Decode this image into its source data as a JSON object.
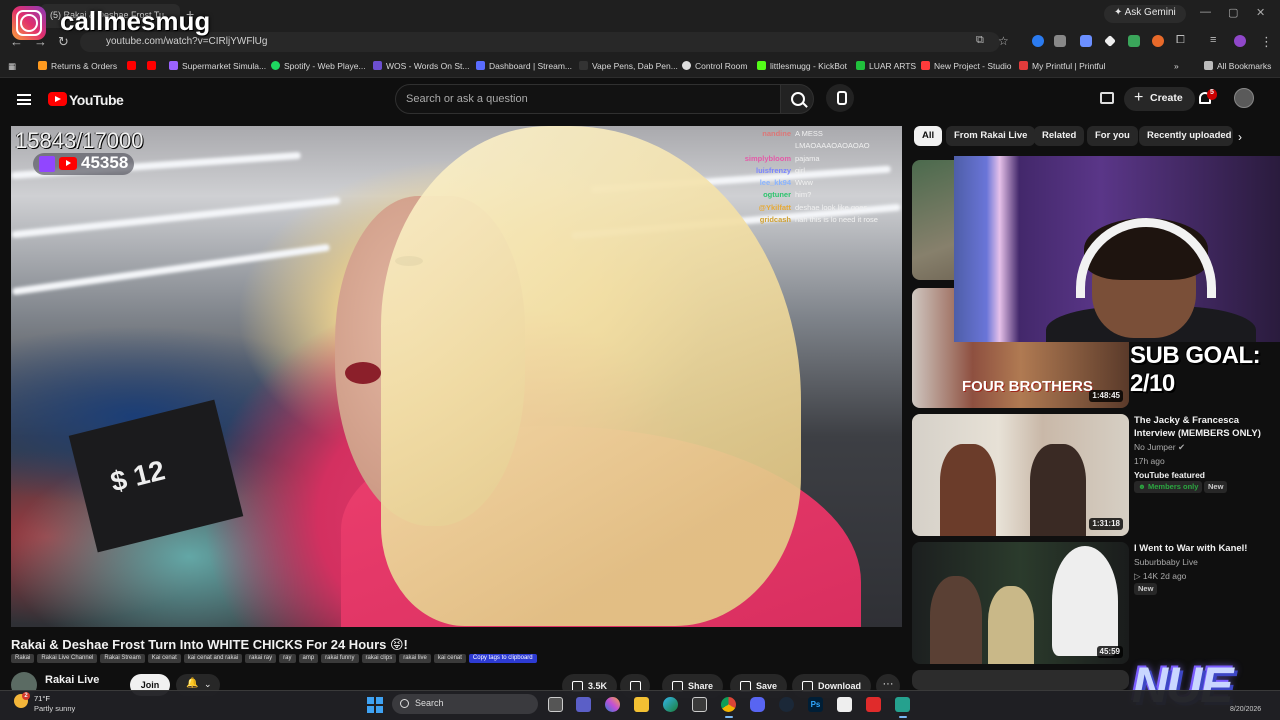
{
  "browser": {
    "tab_title": "(5) Rakai & Deshae Frost Tu",
    "new_tab_label": "+",
    "ask_gemini": "Ask Gemini",
    "url": "youtube.com/watch?v=CIRljYWFlUg",
    "bookmarks": [
      {
        "label": "Returns & Orders",
        "color": "#ff9a1f"
      },
      {
        "label": "",
        "color": "#ff0000"
      },
      {
        "label": "",
        "color": "#ff0000"
      },
      {
        "label": "Supermarket Simula...",
        "color": "#9a62ff"
      },
      {
        "label": "Spotify - Web Playe...",
        "color": "#1ed760"
      },
      {
        "label": "WOS - Words On St...",
        "color": "#6c4fd1"
      },
      {
        "label": "Dashboard | Stream...",
        "color": "#5a6cff"
      },
      {
        "label": "Vape Pens, Dab Pen...",
        "color": "#333333"
      },
      {
        "label": "Control Room",
        "color": "#dddddd"
      },
      {
        "label": "littlesmugg - KickBot",
        "color": "#53fc18"
      },
      {
        "label": "LUAR ARTS",
        "color": "#20c13c"
      },
      {
        "label": "New Project - Studio",
        "color": "#ff3b3b"
      },
      {
        "label": "My Printful | Printful",
        "color": "#e23b3b"
      }
    ],
    "all_bookmarks": "All Bookmarks"
  },
  "watermark": {
    "handle": "callmesmug"
  },
  "youtube": {
    "logo_text": "YouTube",
    "search_placeholder": "Search or ask a question",
    "create_label": "Create",
    "notification_count": "5"
  },
  "video": {
    "sub_counter": "15843/17000",
    "viewer_count": "45358",
    "chat": [
      {
        "user": "nandine",
        "msg": "A MESS"
      },
      {
        "user": "",
        "msg": "LMAOAAAOAOAOAO"
      },
      {
        "user": "simplybloom",
        "msg": "pajama"
      },
      {
        "user": "luisfrenzy",
        "msg": "girl"
      },
      {
        "user": "lee_kk94",
        "msg": "Www"
      },
      {
        "user": "ogtuner",
        "msg": "him?"
      },
      {
        "user": "@Ykilfatt",
        "msg": "deshae look like goes"
      },
      {
        "user": "gridcash",
        "msg": "nah this is lo need it rose"
      }
    ],
    "price_sign": "$ 12",
    "title": "Rakai & Deshae Frost Turn Into WHITE CHICKS For 24 Hours 😝!",
    "tags": [
      "Rakai",
      "Rakai Live Channel",
      "Rakai Stream",
      "Kai cenat",
      "kai cenat and rakai",
      "rakai ray",
      "ray",
      "amp",
      "rakai funny",
      "rakai clips",
      "rakai live",
      "kai cenat"
    ],
    "copy_tags": "Copy tags to clipboard",
    "channel": "Rakai Live",
    "join": "Join",
    "likes": "3.5K",
    "share": "Share",
    "save": "Save",
    "download": "Download",
    "more": "···"
  },
  "overlay": {
    "sub_goal": "SUB GOAL: 2/10",
    "nue_logo": "NUE"
  },
  "sidebar": {
    "chips": [
      "All",
      "From Rakai Live",
      "Related",
      "For you",
      "Recently uploaded"
    ],
    "videos": [
      {
        "title": "",
        "channel": "",
        "meta": "",
        "duration": "",
        "badge": ""
      },
      {
        "title": "",
        "channel": "",
        "meta": "",
        "duration": "1:48:45",
        "badge": "",
        "overlay_text": "FOUR BROTHERS"
      },
      {
        "title": "The Jacky & Francesca Interview (MEMBERS ONLY)",
        "channel": "No Jumper",
        "meta": "17h ago",
        "featured": "YouTube featured",
        "members": "Members only",
        "badge": "New",
        "duration": "1:31:18"
      },
      {
        "title": "I Went to War with Kanel!",
        "channel": "Suburbbaby Live",
        "meta": "14K  2d ago",
        "badge": "New",
        "duration": "45:59"
      }
    ]
  },
  "taskbar": {
    "temperature": "71°F",
    "condition": "Partly sunny",
    "weather_alert": "2",
    "search_label": "Search",
    "date": "8/20/2026"
  }
}
